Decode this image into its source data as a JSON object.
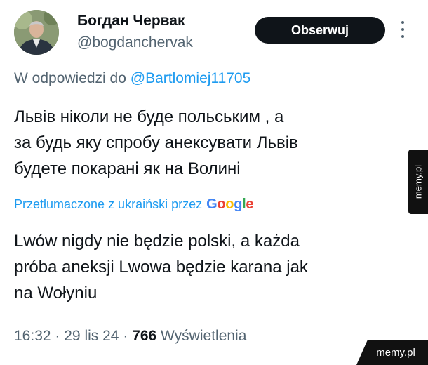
{
  "author": {
    "name": "Богдан Червак",
    "handle": "@bogdanchervak"
  },
  "actions": {
    "follow_label": "Obserwuj",
    "more_icon": "more-vertical-icon"
  },
  "reply": {
    "prefix": "W odpowiedzi do",
    "mention": "@Bartlomiej11705"
  },
  "tweet": {
    "lines": [
      "Львів ніколи не буде польським , а",
      "за будь яку спробу анексувати Львів",
      "будете покарані як на Волині"
    ]
  },
  "translation": {
    "note": "Przetłumaczone z ukraiński przez",
    "provider": "Google",
    "lines": [
      "Lwów nigdy nie będzie polski, a każda",
      "próba aneksji Lwowa będzie karana jak",
      "na Wołyniu"
    ]
  },
  "meta": {
    "time": "16:32",
    "date": "29 lis 24",
    "views_count": "766",
    "views_label": "Wyświetlenia",
    "separator": "·"
  },
  "watermarks": {
    "side": "memy.pl",
    "bottom": "memy.pl"
  },
  "colors": {
    "accent": "#1d9bf0",
    "text": "#0f1419",
    "secondary": "#536471",
    "button_bg": "#0f1419"
  }
}
